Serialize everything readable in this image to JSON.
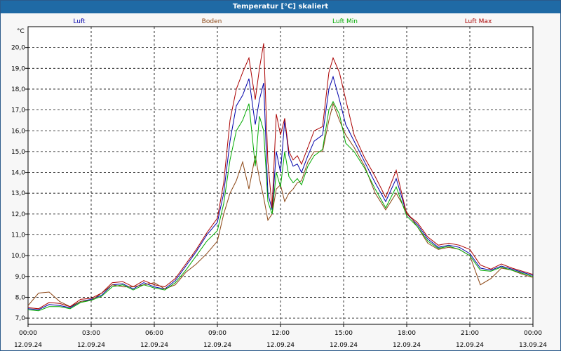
{
  "title": "Temperatur [°C] skaliert",
  "chart_data": {
    "type": "line",
    "title": "Temperatur [°C] skaliert",
    "ylabel": "°C",
    "ylim": [
      6.7,
      21.0
    ],
    "xlim": [
      0,
      24
    ],
    "yticks": [
      "20,0",
      "19,0",
      "18,0",
      "17,0",
      "16,0",
      "15,0",
      "14,0",
      "13,0",
      "12,0",
      "11,0",
      "10,0",
      "9,0",
      "8,0",
      "7,0"
    ],
    "xticks": [
      {
        "time": "00:00",
        "date": "12.09.24"
      },
      {
        "time": "03:00",
        "date": "12.09.24"
      },
      {
        "time": "06:00",
        "date": "12.09.24"
      },
      {
        "time": "09:00",
        "date": "12.09.24"
      },
      {
        "time": "12:00",
        "date": "12.09.24"
      },
      {
        "time": "15:00",
        "date": "12.09.24"
      },
      {
        "time": "18:00",
        "date": "12.09.24"
      },
      {
        "time": "21:00",
        "date": "12.09.24"
      },
      {
        "time": "00:00",
        "date": "13.09.24"
      }
    ],
    "grid": true,
    "legend_position": "top",
    "series": [
      {
        "name": "Luft",
        "color": "#0000aa",
        "points": [
          [
            0,
            7.45
          ],
          [
            0.5,
            7.4
          ],
          [
            1,
            7.65
          ],
          [
            1.5,
            7.6
          ],
          [
            2,
            7.5
          ],
          [
            2.5,
            7.8
          ],
          [
            3,
            7.9
          ],
          [
            3.5,
            8.1
          ],
          [
            4,
            8.6
          ],
          [
            4.5,
            8.65
          ],
          [
            5,
            8.4
          ],
          [
            5.5,
            8.7
          ],
          [
            6,
            8.5
          ],
          [
            6.5,
            8.4
          ],
          [
            7,
            8.8
          ],
          [
            7.5,
            9.5
          ],
          [
            8,
            10.2
          ],
          [
            8.5,
            11.0
          ],
          [
            9,
            11.6
          ],
          [
            9.3,
            13.0
          ],
          [
            9.6,
            15.5
          ],
          [
            9.9,
            17.2
          ],
          [
            10.2,
            17.7
          ],
          [
            10.5,
            18.5
          ],
          [
            10.8,
            16.3
          ],
          [
            11,
            17.5
          ],
          [
            11.2,
            18.3
          ],
          [
            11.4,
            13.0
          ],
          [
            11.6,
            12.2
          ],
          [
            11.8,
            15.0
          ],
          [
            12,
            14.0
          ],
          [
            12.2,
            16.5
          ],
          [
            12.4,
            14.8
          ],
          [
            12.6,
            14.3
          ],
          [
            12.8,
            14.4
          ],
          [
            13,
            14.0
          ],
          [
            13.3,
            14.8
          ],
          [
            13.6,
            15.5
          ],
          [
            14,
            15.8
          ],
          [
            14.3,
            18.0
          ],
          [
            14.5,
            18.6
          ],
          [
            14.8,
            17.5
          ],
          [
            15.1,
            16.3
          ],
          [
            15.5,
            15.5
          ],
          [
            16,
            14.5
          ],
          [
            16.5,
            13.5
          ],
          [
            17,
            12.6
          ],
          [
            17.5,
            13.7
          ],
          [
            18,
            12.0
          ],
          [
            18.5,
            11.5
          ],
          [
            19,
            10.8
          ],
          [
            19.5,
            10.4
          ],
          [
            20,
            10.5
          ],
          [
            20.5,
            10.4
          ],
          [
            21,
            10.1
          ],
          [
            21.5,
            9.4
          ],
          [
            22,
            9.3
          ],
          [
            22.5,
            9.5
          ],
          [
            23,
            9.35
          ],
          [
            23.5,
            9.2
          ],
          [
            24,
            9.05
          ]
        ]
      },
      {
        "name": "Boden",
        "color": "#8b4513",
        "points": [
          [
            0,
            7.6
          ],
          [
            0.5,
            8.2
          ],
          [
            1,
            8.25
          ],
          [
            1.5,
            7.8
          ],
          [
            2,
            7.55
          ],
          [
            2.5,
            7.8
          ],
          [
            3,
            7.85
          ],
          [
            3.5,
            8.2
          ],
          [
            4,
            8.6
          ],
          [
            4.5,
            8.5
          ],
          [
            5,
            8.5
          ],
          [
            5.5,
            8.6
          ],
          [
            6,
            8.7
          ],
          [
            6.5,
            8.4
          ],
          [
            7,
            8.6
          ],
          [
            7.5,
            9.2
          ],
          [
            8,
            9.6
          ],
          [
            8.5,
            10.1
          ],
          [
            9,
            10.7
          ],
          [
            9.3,
            12.0
          ],
          [
            9.6,
            13.0
          ],
          [
            9.9,
            13.6
          ],
          [
            10.2,
            14.5
          ],
          [
            10.5,
            13.2
          ],
          [
            10.8,
            14.8
          ],
          [
            11,
            13.7
          ],
          [
            11.2,
            12.8
          ],
          [
            11.4,
            11.7
          ],
          [
            11.6,
            12.0
          ],
          [
            11.8,
            13.2
          ],
          [
            12,
            13.4
          ],
          [
            12.2,
            12.6
          ],
          [
            12.4,
            13.0
          ],
          [
            12.6,
            13.2
          ],
          [
            12.8,
            13.5
          ],
          [
            13,
            13.6
          ],
          [
            13.3,
            14.5
          ],
          [
            13.6,
            15.0
          ],
          [
            14,
            15.0
          ],
          [
            14.3,
            16.5
          ],
          [
            14.5,
            17.3
          ],
          [
            14.8,
            16.5
          ],
          [
            15.1,
            15.8
          ],
          [
            15.5,
            15.2
          ],
          [
            16,
            14.3
          ],
          [
            16.5,
            13.0
          ],
          [
            17,
            12.2
          ],
          [
            17.5,
            13.0
          ],
          [
            18,
            12.1
          ],
          [
            18.5,
            11.4
          ],
          [
            19,
            10.6
          ],
          [
            19.5,
            10.3
          ],
          [
            20,
            10.4
          ],
          [
            20.5,
            10.3
          ],
          [
            21,
            10.0
          ],
          [
            21.5,
            8.6
          ],
          [
            22,
            8.9
          ],
          [
            22.5,
            9.4
          ],
          [
            23,
            9.3
          ],
          [
            23.5,
            9.1
          ],
          [
            24,
            8.95
          ]
        ]
      },
      {
        "name": "Luft Min",
        "color": "#00aa00",
        "points": [
          [
            0,
            7.4
          ],
          [
            0.5,
            7.35
          ],
          [
            1,
            7.55
          ],
          [
            1.5,
            7.55
          ],
          [
            2,
            7.45
          ],
          [
            2.5,
            7.75
          ],
          [
            3,
            7.85
          ],
          [
            3.5,
            8.05
          ],
          [
            4,
            8.5
          ],
          [
            4.5,
            8.6
          ],
          [
            5,
            8.35
          ],
          [
            5.5,
            8.6
          ],
          [
            6,
            8.45
          ],
          [
            6.5,
            8.35
          ],
          [
            7,
            8.7
          ],
          [
            7.5,
            9.3
          ],
          [
            8,
            10.0
          ],
          [
            8.5,
            10.7
          ],
          [
            9,
            11.2
          ],
          [
            9.3,
            12.5
          ],
          [
            9.6,
            14.6
          ],
          [
            9.9,
            16.0
          ],
          [
            10.2,
            16.5
          ],
          [
            10.5,
            17.3
          ],
          [
            10.8,
            14.3
          ],
          [
            11,
            16.7
          ],
          [
            11.2,
            16.0
          ],
          [
            11.4,
            12.6
          ],
          [
            11.6,
            12.0
          ],
          [
            11.8,
            14.0
          ],
          [
            12,
            13.3
          ],
          [
            12.2,
            15.0
          ],
          [
            12.4,
            13.8
          ],
          [
            12.6,
            13.5
          ],
          [
            12.8,
            13.7
          ],
          [
            13,
            13.4
          ],
          [
            13.3,
            14.3
          ],
          [
            13.6,
            14.8
          ],
          [
            14,
            15.1
          ],
          [
            14.3,
            17.0
          ],
          [
            14.5,
            17.4
          ],
          [
            14.8,
            16.8
          ],
          [
            15.1,
            15.4
          ],
          [
            15.5,
            15.0
          ],
          [
            16,
            14.2
          ],
          [
            16.5,
            13.2
          ],
          [
            17,
            12.3
          ],
          [
            17.5,
            13.3
          ],
          [
            18,
            11.9
          ],
          [
            18.5,
            11.4
          ],
          [
            19,
            10.7
          ],
          [
            19.5,
            10.35
          ],
          [
            20,
            10.45
          ],
          [
            20.5,
            10.3
          ],
          [
            21,
            10.0
          ],
          [
            21.5,
            9.3
          ],
          [
            22,
            9.25
          ],
          [
            22.5,
            9.45
          ],
          [
            23,
            9.3
          ],
          [
            23.5,
            9.15
          ],
          [
            24,
            9.0
          ]
        ]
      },
      {
        "name": "Luft Max",
        "color": "#aa0000",
        "points": [
          [
            0,
            7.5
          ],
          [
            0.5,
            7.45
          ],
          [
            1,
            7.75
          ],
          [
            1.5,
            7.7
          ],
          [
            2,
            7.55
          ],
          [
            2.5,
            7.9
          ],
          [
            3,
            7.95
          ],
          [
            3.5,
            8.2
          ],
          [
            4,
            8.7
          ],
          [
            4.5,
            8.75
          ],
          [
            5,
            8.5
          ],
          [
            5.5,
            8.8
          ],
          [
            6,
            8.6
          ],
          [
            6.5,
            8.5
          ],
          [
            7,
            8.9
          ],
          [
            7.5,
            9.6
          ],
          [
            8,
            10.3
          ],
          [
            8.5,
            11.1
          ],
          [
            9,
            11.8
          ],
          [
            9.3,
            13.5
          ],
          [
            9.6,
            16.5
          ],
          [
            9.9,
            18.0
          ],
          [
            10.2,
            18.8
          ],
          [
            10.5,
            19.5
          ],
          [
            10.8,
            17.5
          ],
          [
            11,
            19.0
          ],
          [
            11.2,
            20.2
          ],
          [
            11.4,
            14.5
          ],
          [
            11.6,
            12.3
          ],
          [
            11.8,
            16.8
          ],
          [
            12,
            15.8
          ],
          [
            12.2,
            16.6
          ],
          [
            12.4,
            15.0
          ],
          [
            12.6,
            14.6
          ],
          [
            12.8,
            14.8
          ],
          [
            13,
            14.4
          ],
          [
            13.3,
            15.2
          ],
          [
            13.6,
            16.0
          ],
          [
            14,
            16.2
          ],
          [
            14.3,
            18.8
          ],
          [
            14.5,
            19.5
          ],
          [
            14.8,
            18.8
          ],
          [
            15.1,
            17.5
          ],
          [
            15.5,
            15.8
          ],
          [
            16,
            14.7
          ],
          [
            16.5,
            13.8
          ],
          [
            17,
            12.8
          ],
          [
            17.5,
            14.1
          ],
          [
            18,
            12.0
          ],
          [
            18.5,
            11.6
          ],
          [
            19,
            10.9
          ],
          [
            19.5,
            10.5
          ],
          [
            20,
            10.6
          ],
          [
            20.5,
            10.5
          ],
          [
            21,
            10.3
          ],
          [
            21.5,
            9.55
          ],
          [
            22,
            9.35
          ],
          [
            22.5,
            9.6
          ],
          [
            23,
            9.4
          ],
          [
            23.5,
            9.25
          ],
          [
            24,
            9.1
          ]
        ]
      }
    ]
  }
}
